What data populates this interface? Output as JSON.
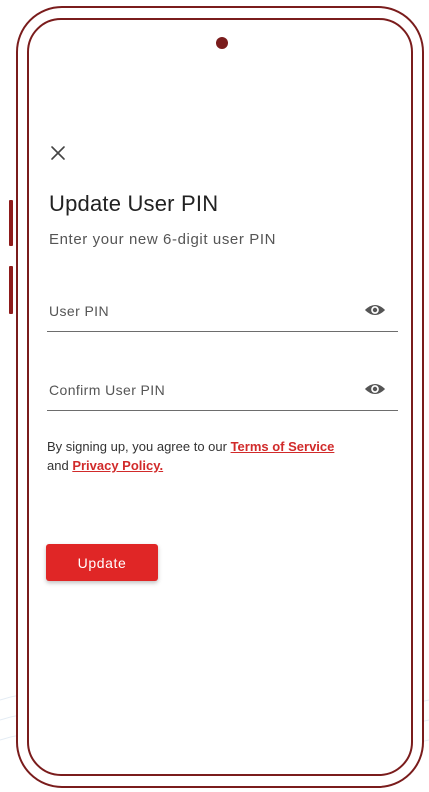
{
  "screen": {
    "close_icon": "close-icon",
    "title": "Update User PIN",
    "subtitle": "Enter your new 6-digit user PIN"
  },
  "form": {
    "pin_placeholder": "User PIN",
    "pin_value": "",
    "confirm_placeholder": "Confirm User PIN",
    "confirm_value": "",
    "eye_icon": "eye-icon"
  },
  "terms": {
    "prefix": "By signing up, you agree to our ",
    "terms_link": "Terms of Service",
    "conjunction": "and ",
    "privacy_link": "Privacy Policy."
  },
  "actions": {
    "update_label": "Update"
  },
  "colors": {
    "accent": "#e02626",
    "frame": "#7a1c1c",
    "link": "#d12a2a"
  }
}
